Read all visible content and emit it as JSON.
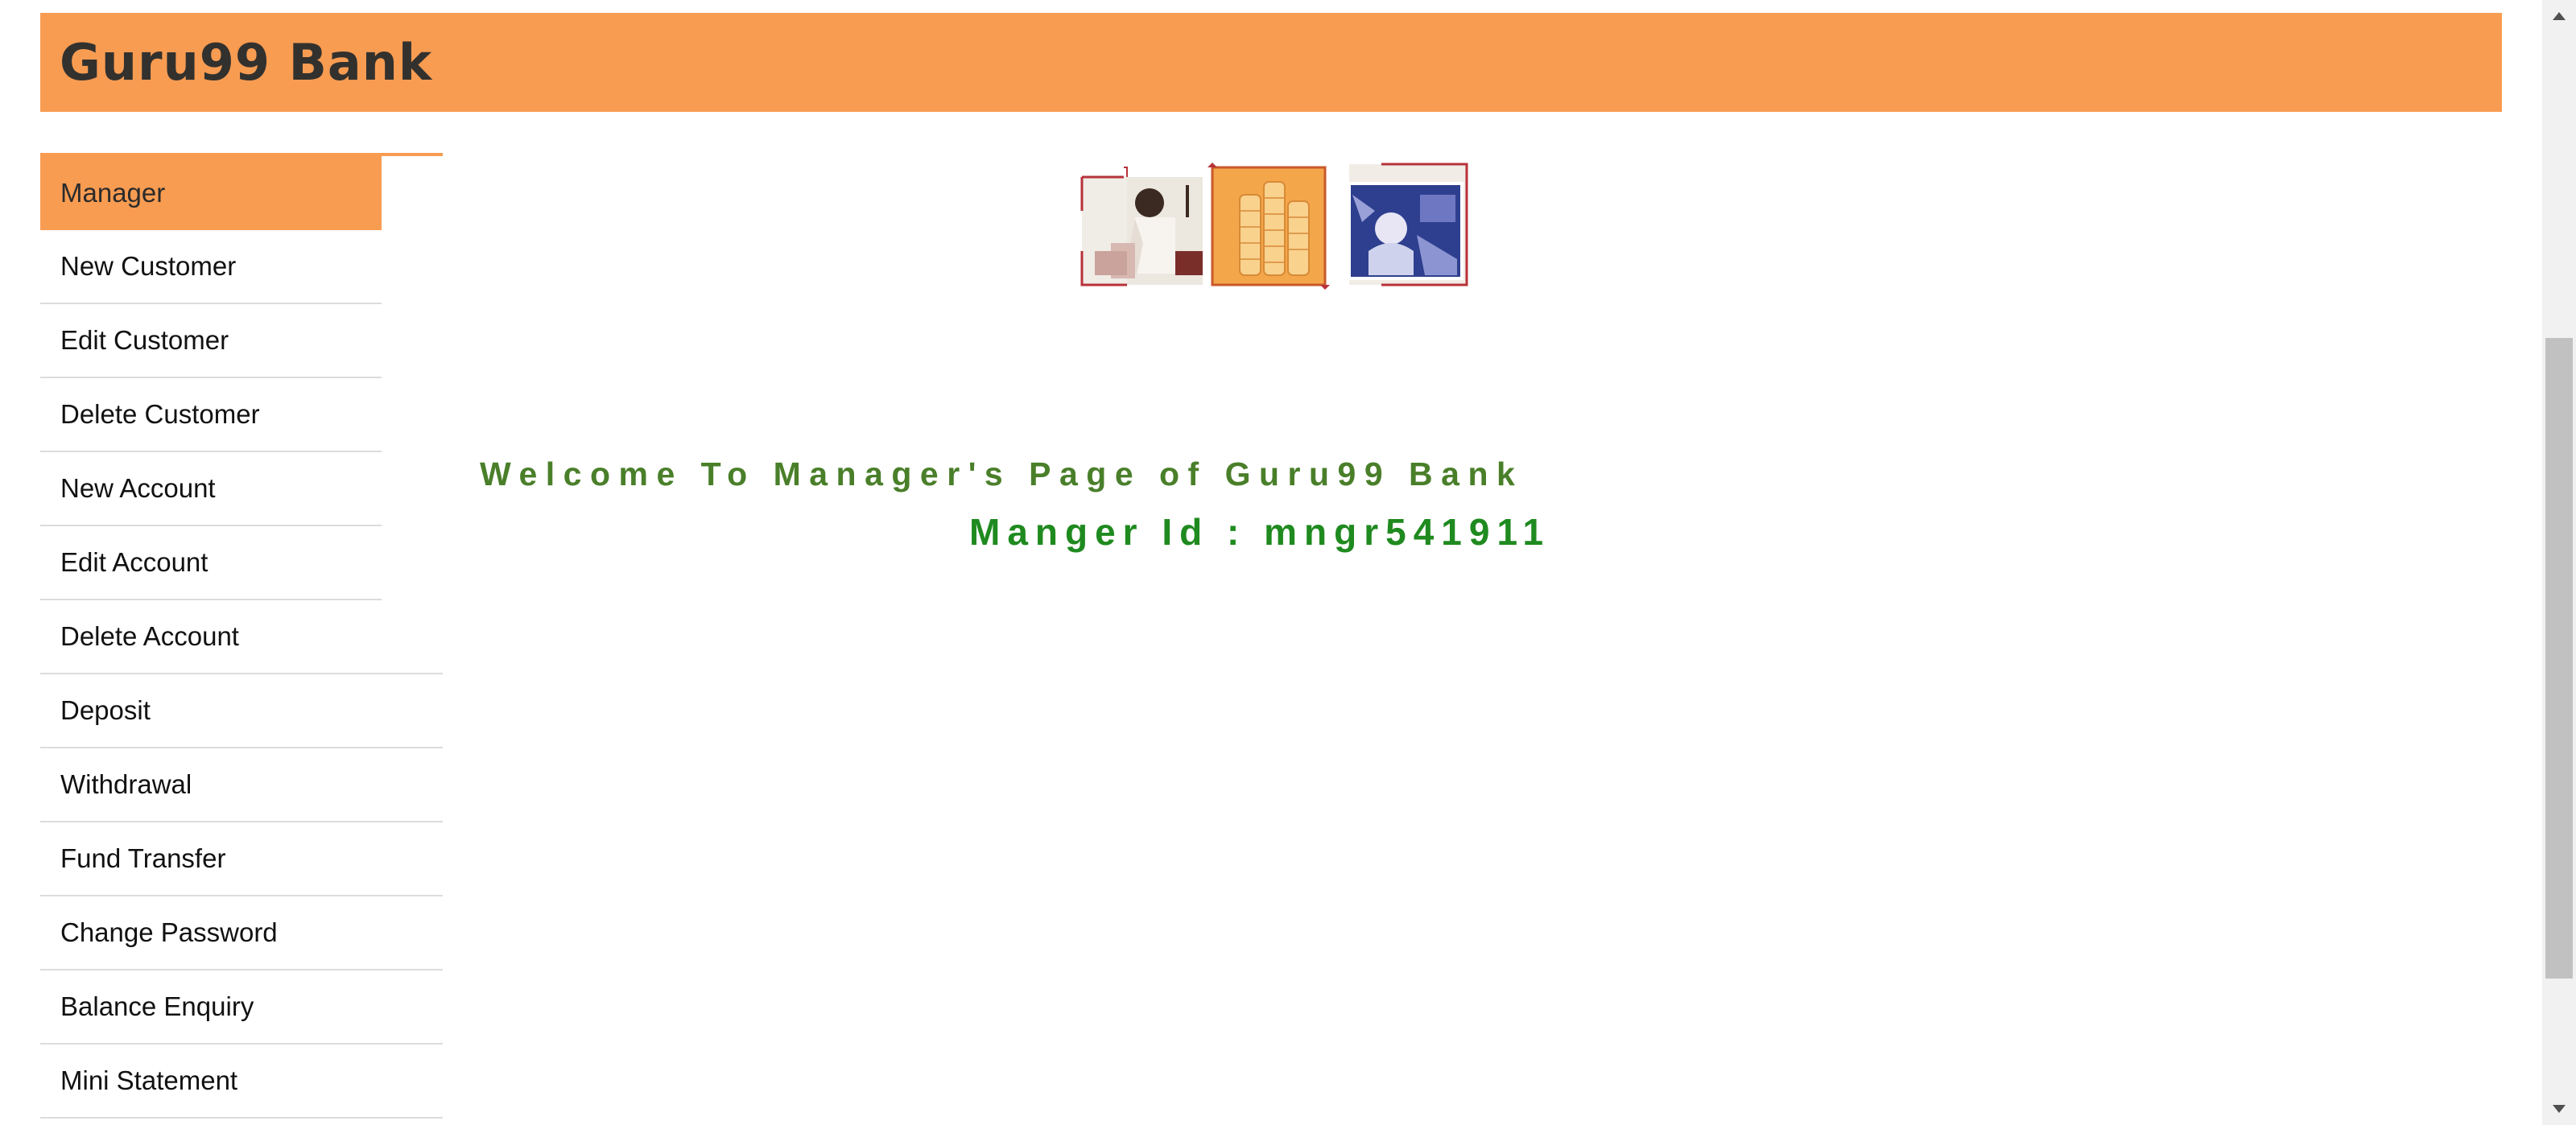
{
  "header": {
    "brand": "Guru99 Bank"
  },
  "sidebar": {
    "items": [
      {
        "label": "Manager",
        "active": true
      },
      {
        "label": "New Customer"
      },
      {
        "label": "Edit Customer"
      },
      {
        "label": "Delete Customer"
      },
      {
        "label": "New Account"
      },
      {
        "label": "Edit Account"
      },
      {
        "label": "Delete Account"
      },
      {
        "label": "Deposit"
      },
      {
        "label": "Withdrawal"
      },
      {
        "label": "Fund Transfer"
      },
      {
        "label": "Change Password"
      },
      {
        "label": "Balance Enquiry"
      },
      {
        "label": "Mini Statement"
      }
    ]
  },
  "main": {
    "welcome": "Welcome To Manager's Page of Guru99 Bank",
    "manager_id": "Manger Id : mngr541911"
  },
  "colors": {
    "header_bg": "#f89c52",
    "welcome_text": "#4a7f2a",
    "manager_id_text": "#1f8a1f"
  },
  "icons": {
    "banner": "bank-banner-images",
    "scroll_up": "chevron-up-icon",
    "scroll_down": "chevron-down-icon"
  }
}
